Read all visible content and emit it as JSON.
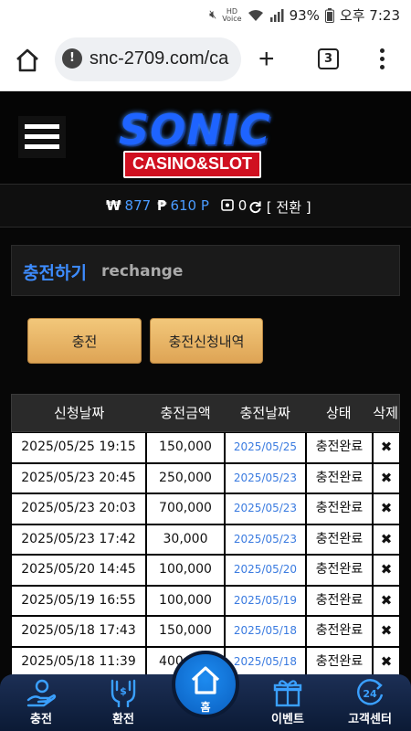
{
  "status_bar": {
    "battery": "93%",
    "time": "오후 7:23",
    "hd_label": "HD",
    "voice_label": "Voice"
  },
  "browser": {
    "url": "snc-2709.com/ca",
    "tab_count": "3"
  },
  "balance": {
    "won_symbol": "₩",
    "won_value": "877",
    "point_symbol": "₱",
    "point_value": "610 P",
    "chip_value": "0",
    "convert_label": "[ 전환 ]"
  },
  "panel": {
    "title_ko": "충전하기",
    "title_en": "rechange",
    "charge_button": "충전",
    "history_button": "충전신청내역"
  },
  "table": {
    "headers": [
      "신청날짜",
      "충전금액",
      "충전날짜",
      "상태",
      "삭제"
    ],
    "rows": [
      {
        "requested": "2025/05/25 19:15",
        "amount": "150,000",
        "charged": "2025/05/25",
        "status": "충전완료",
        "delete": "✖"
      },
      {
        "requested": "2025/05/23 20:45",
        "amount": "250,000",
        "charged": "2025/05/23",
        "status": "충전완료",
        "delete": "✖"
      },
      {
        "requested": "2025/05/23 20:03",
        "amount": "700,000",
        "charged": "2025/05/23",
        "status": "충전완료",
        "delete": "✖"
      },
      {
        "requested": "2025/05/23 17:42",
        "amount": "30,000",
        "charged": "2025/05/23",
        "status": "충전완료",
        "delete": "✖"
      },
      {
        "requested": "2025/05/20 14:45",
        "amount": "100,000",
        "charged": "2025/05/20",
        "status": "충전완료",
        "delete": "✖"
      },
      {
        "requested": "2025/05/19 16:55",
        "amount": "100,000",
        "charged": "2025/05/19",
        "status": "충전완료",
        "delete": "✖"
      },
      {
        "requested": "2025/05/18 17:43",
        "amount": "150,000",
        "charged": "2025/05/18",
        "status": "충전완료",
        "delete": "✖"
      },
      {
        "requested": "2025/05/18 11:39",
        "amount": "400,000",
        "charged": "2025/05/18",
        "status": "충전완료",
        "delete": "✖"
      }
    ]
  },
  "logo": {
    "main": "SONIC",
    "sub": "CASINO&SLOT"
  },
  "bottom_nav": {
    "charge": "충전",
    "exchange": "환전",
    "home": "홈",
    "event": "이벤트",
    "support": "고객센터"
  },
  "colors": {
    "accent_blue": "#3d8cff",
    "gold_button": "#e8b466",
    "nav_background": "#13254a"
  }
}
